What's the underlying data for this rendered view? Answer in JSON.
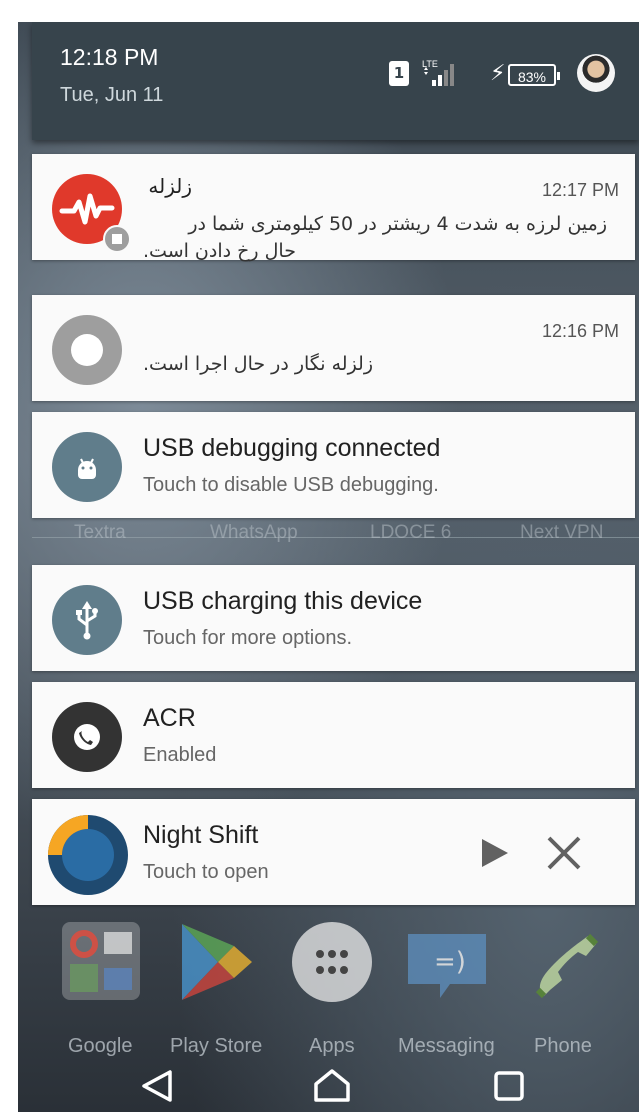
{
  "status": {
    "time": "12:18 PM",
    "date": "Tue, Jun 11",
    "sim_slot": "1",
    "network": "LTE",
    "battery": "83%"
  },
  "notifications": [
    {
      "title": "زلزله",
      "time": "12:17 PM",
      "body_line1": "زمین لرزه به شدت 4 ریشتر در 50 کیلومتری شما در",
      "body_line2": "حال رخ دادن است."
    },
    {
      "time": "12:16 PM",
      "body": "زلزله نگار در حال اجرا است."
    },
    {
      "title": "USB debugging connected",
      "subtitle": "Touch to disable USB debugging."
    },
    {
      "title": "USB charging this device",
      "subtitle": "Touch for more options."
    },
    {
      "title": "ACR",
      "subtitle": "Enabled"
    },
    {
      "title": "Night Shift",
      "subtitle": "Touch to open"
    }
  ],
  "background_apps": [
    "Textra",
    "WhatsApp",
    "LDOCE 6",
    "Next VPN"
  ],
  "dock": [
    "Google",
    "Play Store",
    "Apps",
    "Messaging",
    "Phone"
  ],
  "colors": {
    "header": "#37444c",
    "quake_red": "#e0392b",
    "usb_teal": "#607d8b",
    "acr_dark": "#333333",
    "nightshift_blue": "#1f5a8a",
    "nightshift_orange": "#f6a623"
  }
}
